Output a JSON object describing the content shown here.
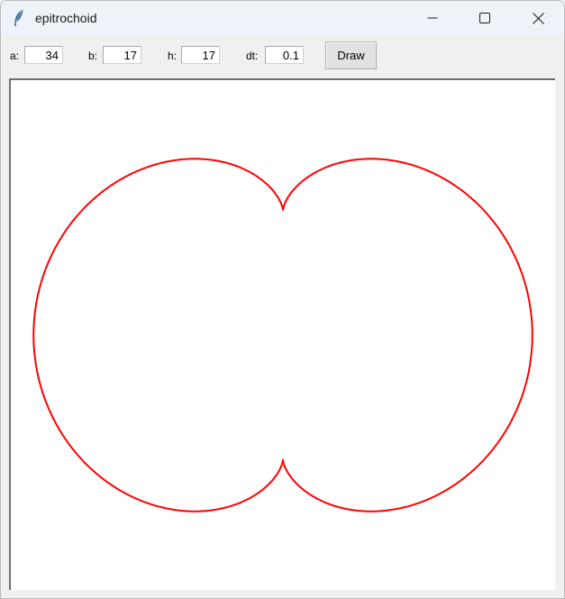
{
  "window": {
    "title": "epitrochoid",
    "icon": "feather-icon",
    "controls": {
      "minimize": "minimize-icon",
      "maximize": "maximize-icon",
      "close": "close-icon"
    }
  },
  "toolbar": {
    "a_label": "a:",
    "a_value": "34",
    "b_label": "b:",
    "b_value": "17",
    "h_label": "h:",
    "h_value": "17",
    "dt_label": "dt:",
    "dt_value": "0.1",
    "draw_label": "Draw"
  },
  "canvas": {
    "curve_color": "#ff0000",
    "background": "#ffffff"
  }
}
